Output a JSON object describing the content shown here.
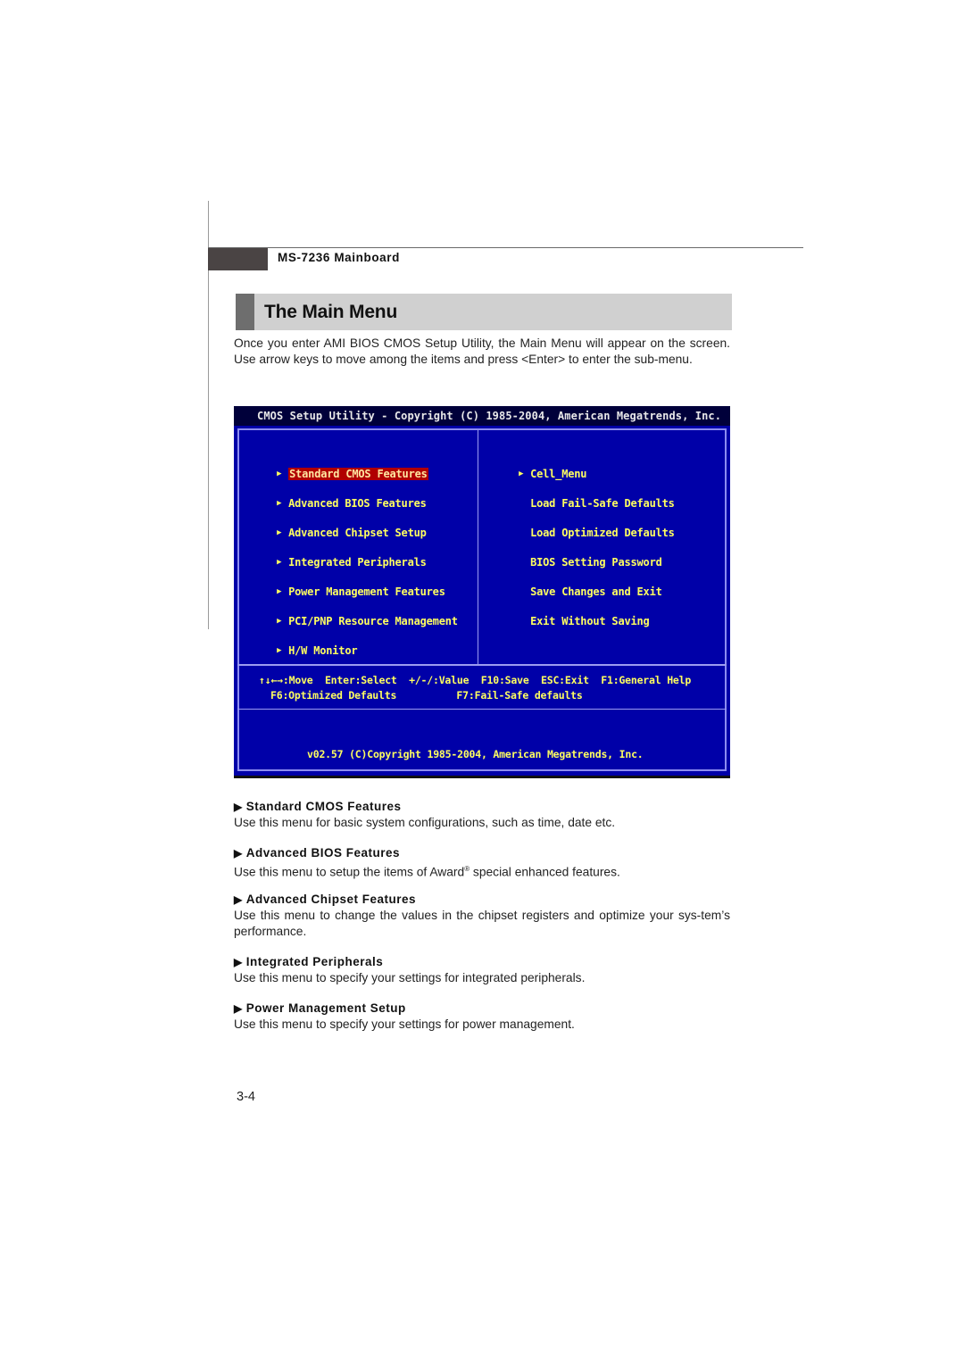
{
  "header": {
    "manual_title": "MS-7236 Mainboard"
  },
  "section": {
    "title": "The Main Menu",
    "intro": "Once you enter AMI BIOS CMOS Setup Utility, the Main Menu will appear on the screen. Use arrow keys to move among the items and press <Enter> to enter the sub-menu."
  },
  "bios": {
    "title": "CMOS Setup Utility - Copyright (C) 1985-2004, American Megatrends, Inc.",
    "colors": {
      "background": "#0000a8",
      "text": "#ffff60",
      "selected": "#b00000",
      "border": "#8c8cf0"
    },
    "left_items": [
      {
        "label": "Standard CMOS Features",
        "submenu": true,
        "selected": true
      },
      {
        "label": "Advanced BIOS Features",
        "submenu": true
      },
      {
        "label": "Advanced Chipset Setup",
        "submenu": true
      },
      {
        "label": "Integrated Peripherals",
        "submenu": true
      },
      {
        "label": "Power Management Features",
        "submenu": true
      },
      {
        "label": "PCI/PNP Resource Management",
        "submenu": true
      },
      {
        "label": "H/W Monitor",
        "submenu": true
      }
    ],
    "right_items": [
      {
        "label": "Cell_Menu",
        "submenu": true
      },
      {
        "label": "Load Fail-Safe Defaults",
        "submenu": false
      },
      {
        "label": "Load Optimized Defaults",
        "submenu": false
      },
      {
        "label": "BIOS Setting Password",
        "submenu": false
      },
      {
        "label": "Save Changes and Exit",
        "submenu": false
      },
      {
        "label": "Exit Without Saving",
        "submenu": false
      }
    ],
    "help_line1": "↑↓←→:Move  Enter:Select  +/-/:Value  F10:Save  ESC:Exit  F1:General Help",
    "help_line2": "F6:Optimized Defaults          F7:Fail-Safe defaults",
    "footer": "v02.57 (C)Copyright 1985-2004, American Megatrends, Inc.",
    "submenu_arrow": "▶"
  },
  "descriptions": [
    {
      "heading": "Standard CMOS Features",
      "text": "Use this menu for basic system configurations, such as time, date etc."
    },
    {
      "heading": "Advanced BIOS Features",
      "text_before": "Use this menu to setup the items of Award",
      "sup": "®",
      "text_after": " special enhanced features."
    },
    {
      "heading": "Advanced Chipset Features",
      "text": "Use this menu to change the values in the chipset registers and optimize your sys-tem’s performance."
    },
    {
      "heading": "Integrated Peripherals",
      "text": "Use this menu to specify your settings for integrated peripherals."
    },
    {
      "heading": "Power Management Setup",
      "text": "Use this menu to specify your settings for power management."
    }
  ],
  "heading_bullet": "▶",
  "page_number": "3-4"
}
